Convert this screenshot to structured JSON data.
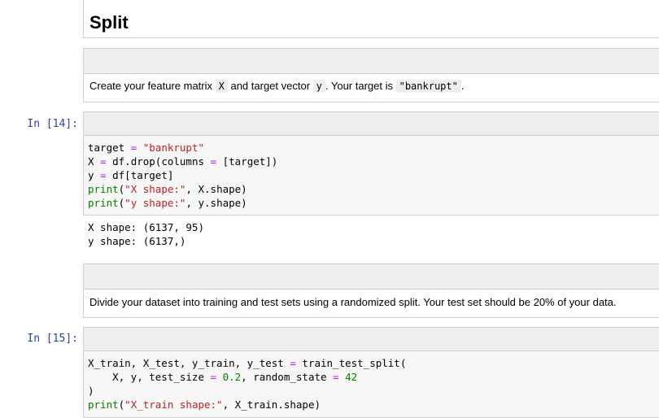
{
  "heading": {
    "text": "Split"
  },
  "markdown1": {
    "pre": "Create your feature matrix ",
    "code1": "X",
    "mid": " and target vector ",
    "code2": "y",
    "mid2": ". Your target is ",
    "code3": "\"bankrupt\"",
    "post": "."
  },
  "cell14": {
    "prompt": "In [14]:",
    "lines": [
      "target = \"bankrupt\"",
      "X = df.drop(columns = [target])",
      "y = df[target]",
      "print(\"X shape:\", X.shape)",
      "print(\"y shape:\", y.shape)"
    ],
    "output": [
      "X shape: (6137, 95)",
      "y shape: (6137,)"
    ]
  },
  "markdown2": {
    "text": "Divide your dataset into training and test sets using a randomized split. Your test set should be 20% of your data."
  },
  "cell15": {
    "prompt": "In [15]:",
    "lines": [
      "X_train, X_test, y_train, y_test = train_test_split(",
      "    X, y, test_size = 0.2, random_state = 42",
      ")",
      "print(\"X_train shape:\", X_train.shape)"
    ]
  }
}
